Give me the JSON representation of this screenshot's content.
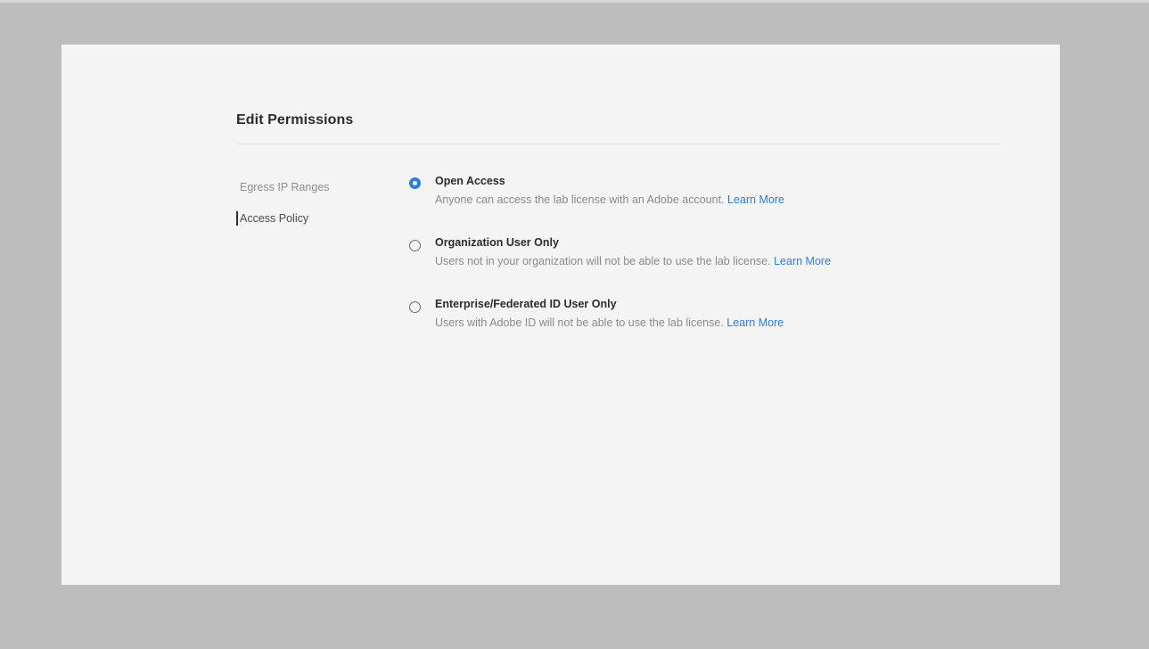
{
  "page": {
    "title": "Edit Permissions"
  },
  "nav": {
    "items": [
      {
        "label": "Egress IP Ranges",
        "active": false
      },
      {
        "label": "Access Policy",
        "active": true
      }
    ]
  },
  "access_policy": {
    "selected": "Open Access",
    "options": [
      {
        "label": "Open Access",
        "description": "Anyone can access the lab license with an Adobe account.",
        "link": "Learn More",
        "checked": true
      },
      {
        "label": "Organization User Only",
        "description": "Users not in your organization will not be able to use the lab license.",
        "link": "Learn More",
        "checked": false
      },
      {
        "label": "Enterprise/Federated ID User Only",
        "description": "Users with Adobe ID will not be able to use the lab license.",
        "link": "Learn More",
        "checked": false
      }
    ]
  },
  "colors": {
    "accent": "#2d7ce0",
    "panel_background": "#f4f4f4",
    "page_background": "#bdbdbd"
  }
}
